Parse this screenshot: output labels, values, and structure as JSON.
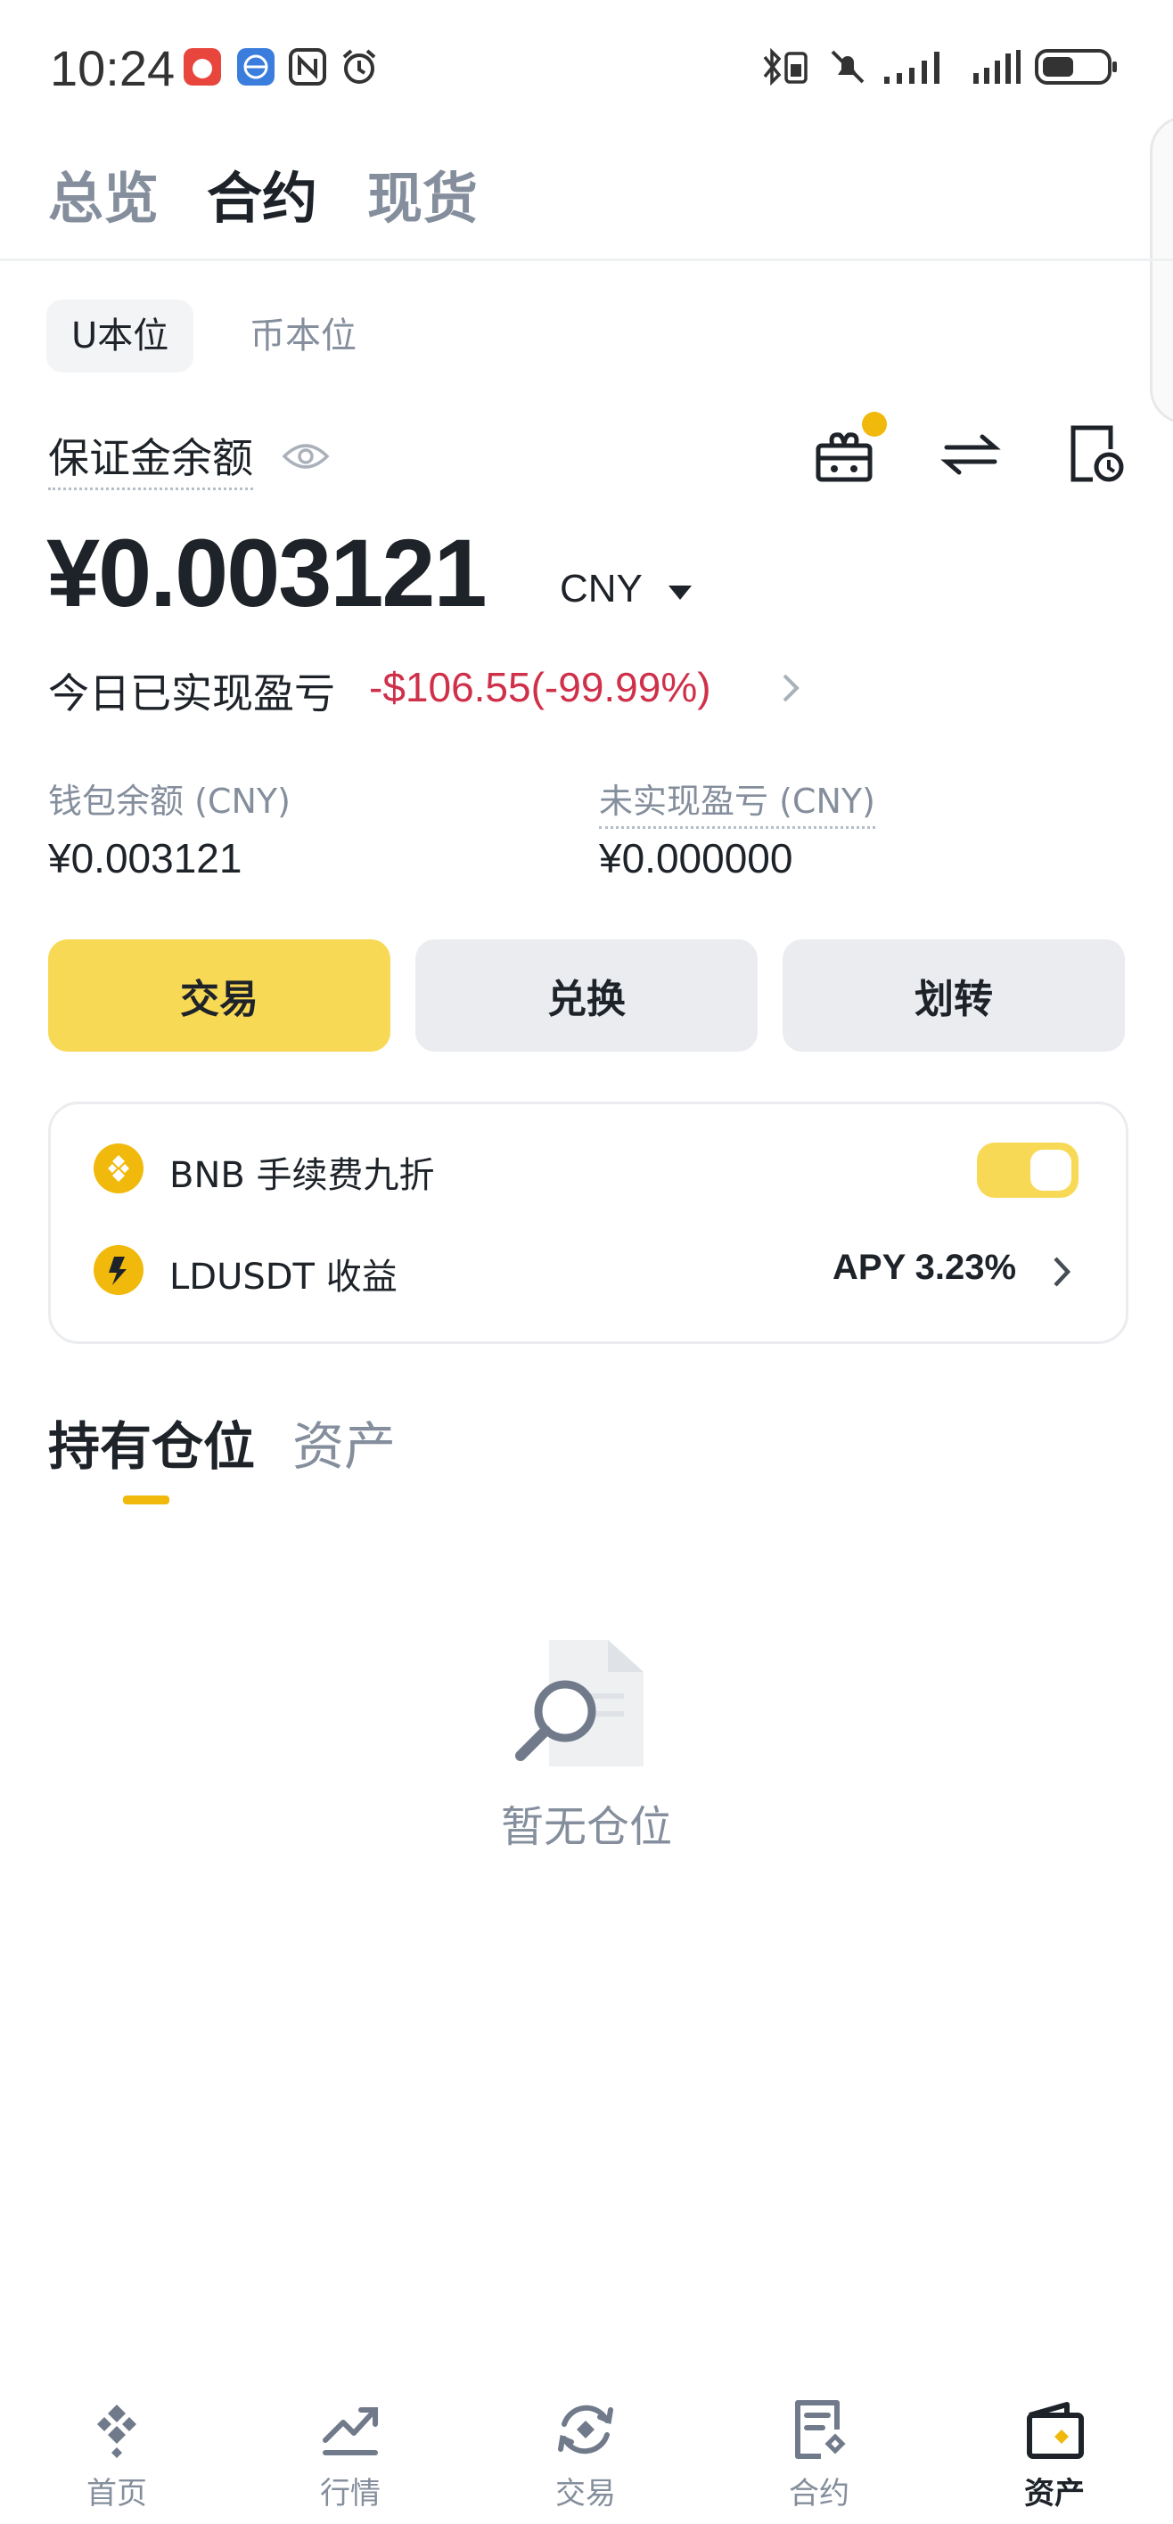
{
  "status_bar": {
    "time": "10:24"
  },
  "top_tabs": [
    {
      "label": "总览",
      "active": false
    },
    {
      "label": "合约",
      "active": true
    },
    {
      "label": "现货",
      "active": false
    }
  ],
  "sub_tabs": [
    {
      "label": "U本位",
      "active": true
    },
    {
      "label": "币本位",
      "active": false
    }
  ],
  "balance": {
    "label": "保证金余额",
    "amount": "¥0.003121",
    "currency": "CNY",
    "today_pnl_label": "今日已实现盈亏",
    "today_pnl_value": "-$106.55(-99.99%)",
    "wallet_label": "钱包余额 (CNY)",
    "wallet_value": "¥0.003121",
    "unrealized_label": "未实现盈亏 (CNY)",
    "unrealized_value": "¥0.000000"
  },
  "actions": {
    "trade": "交易",
    "convert": "兑换",
    "transfer": "划转"
  },
  "card": {
    "bnb_label": "BNB 手续费九折",
    "bnb_toggle_on": true,
    "ldusdt_label": "LDUSDT 收益",
    "apy": "APY 3.23%"
  },
  "position_tabs": [
    {
      "label": "持有仓位",
      "active": true
    },
    {
      "label": "资产",
      "active": false
    }
  ],
  "empty_state": {
    "text": "暂无仓位"
  },
  "bottom_nav": [
    {
      "label": "首页",
      "icon": "home-icon"
    },
    {
      "label": "行情",
      "icon": "markets-icon"
    },
    {
      "label": "交易",
      "icon": "trade-icon"
    },
    {
      "label": "合约",
      "icon": "futures-icon"
    },
    {
      "label": "资产",
      "icon": "wallet-icon",
      "active": true
    }
  ],
  "colors": {
    "accent": "#f0b90b",
    "button_yellow": "#f8d956",
    "loss_red": "#cf304a",
    "muted": "#848e9c"
  }
}
